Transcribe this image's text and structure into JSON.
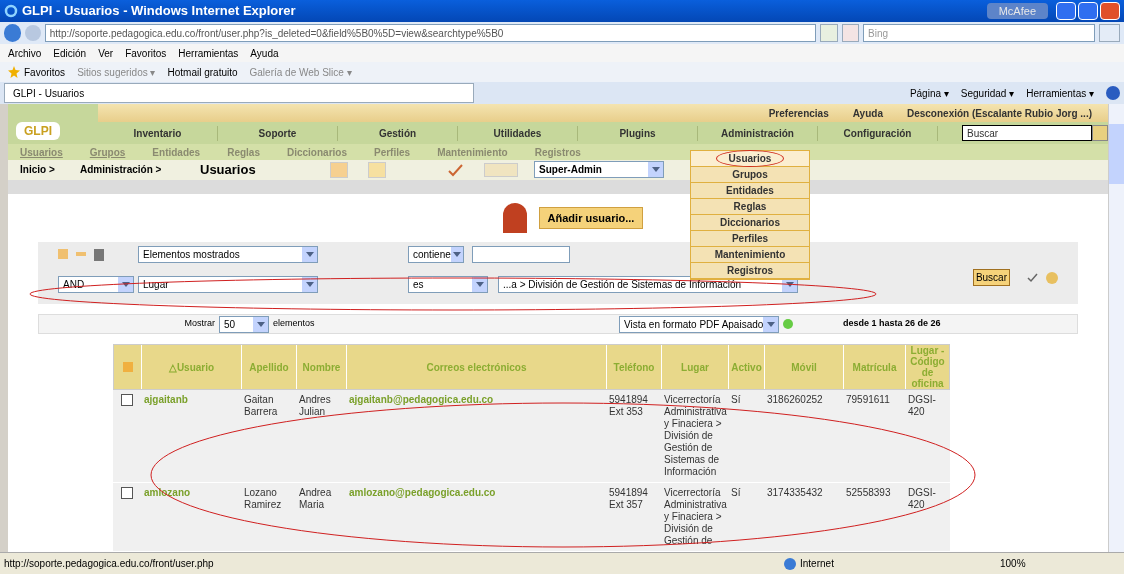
{
  "window": {
    "title": "GLPI - Usuarios - Windows Internet Explorer",
    "addon": "McAfee"
  },
  "address_bar": {
    "url": "http://soporte.pedagogica.edu.co/front/user.php?is_deleted=0&field%5B0%5D=view&searchtype%5B0",
    "search_placeholder": "Bing"
  },
  "menu_bar": [
    "Archivo",
    "Edición",
    "Ver",
    "Favoritos",
    "Herramientas",
    "Ayuda"
  ],
  "favorites_bar": {
    "label": "Favoritos",
    "links": [
      "Sitios sugeridos ▾",
      "Hotmail gratuito",
      "Galería de Web Slice ▾"
    ]
  },
  "tab": {
    "title": "GLPI - Usuarios"
  },
  "command_bar": [
    "Página ▾",
    "Seguridad ▾",
    "Herramientas ▾"
  ],
  "glpi": {
    "logo": "GLPI",
    "top_links": [
      "Preferencias",
      "Ayuda",
      "Desconexión (Escalante Rubio Jorg ...)"
    ],
    "main_menu": [
      "Inventario",
      "Soporte",
      "Gestión",
      "Utilidades",
      "Plugins",
      "Administración",
      "Configuración"
    ],
    "search_placeholder": "Buscar",
    "sub_menu": [
      "Usuarios",
      "Grupos",
      "Entidades",
      "Reglas",
      "Diccionarios",
      "Perfiles",
      "Mantenimiento",
      "Registros"
    ],
    "breadcrumbs": [
      "Inicio >",
      "Administración >",
      "Usuarios"
    ],
    "profile": "Super-Admin",
    "dropdown": [
      {
        "label": "Usuarios",
        "selected": true
      },
      {
        "label": "Grupos",
        "selected": false
      },
      {
        "label": "Entidades",
        "selected": false
      },
      {
        "label": "Reglas",
        "selected": false
      },
      {
        "label": "Diccionarios",
        "selected": false
      },
      {
        "label": "Perfiles",
        "selected": false
      },
      {
        "label": "Mantenimiento",
        "selected": false
      },
      {
        "label": "Registros",
        "selected": false
      }
    ],
    "add_button": "Añadir usuario...",
    "criteria": [
      {
        "field": "Elementos mostrados",
        "operator": "contiene"
      },
      {
        "logic": "AND",
        "field": "Lugar",
        "operator": "es",
        "value": "...a > División de Gestión de Sistemas de Información"
      }
    ],
    "search_button": "Buscar",
    "pager": {
      "show_label": "Mostrar",
      "show_value": "50",
      "show_suffix": "elementos",
      "export": "Vista en formato PDF Apaisado",
      "range": "desde 1 hasta 26 de 26"
    },
    "table": {
      "columns": [
        "△Usuario",
        "Apellido",
        "Nombre",
        "Correos electrónicos",
        "Teléfono",
        "Lugar",
        "Activo",
        "Móvil",
        "Matrícula",
        "Lugar - Código de oficina"
      ],
      "rows": [
        {
          "checked": false,
          "cells": [
            "ajgaitanb",
            "Gaitan Barrera",
            "Andres Julian",
            "ajgaitanb@pedagogica.edu.co",
            "5941894 Ext 353",
            "Vicerrectoría Administrativa y Finaciera > División de Gestión de Sistemas de Información",
            "Sí",
            "3186260252",
            "79591611",
            "DGSI-420"
          ]
        },
        {
          "checked": false,
          "cells": [
            "amlozano",
            "Lozano Ramirez",
            "Andrea Maria",
            "amlozano@pedagogica.edu.co",
            "5941894 Ext 357",
            "Vicerrectoría Administrativa y Finaciera > División de Gestión de",
            "Sí",
            "3174335432",
            "52558393",
            "DGSI-420"
          ]
        }
      ]
    }
  },
  "status_bar": {
    "url": "http://soporte.pedagogica.edu.co/front/user.php",
    "zone": "Internet",
    "zoom": "100%"
  }
}
